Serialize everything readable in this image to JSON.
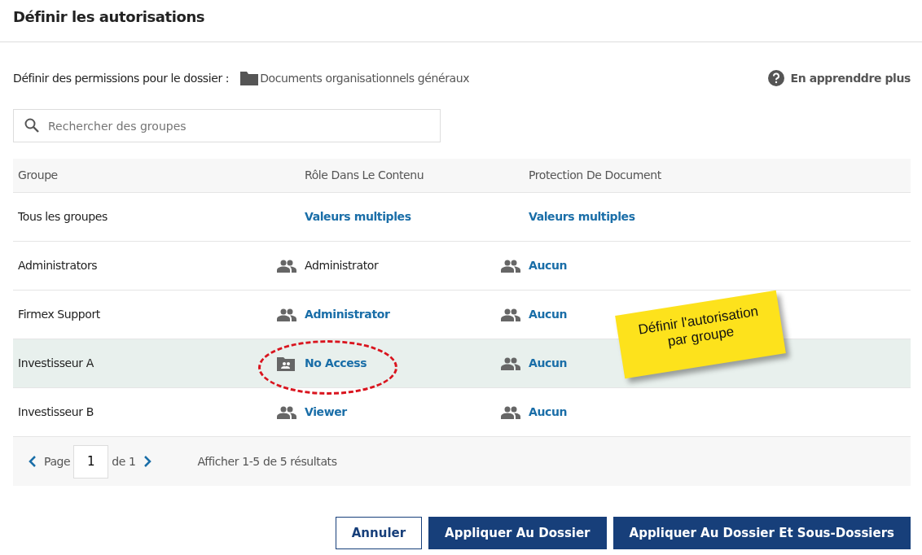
{
  "dialog": {
    "title": "Définir les autorisations"
  },
  "folder_line": {
    "label": "Définir des permissions pour le dossier :",
    "folder": "Documents organisationnels généraux"
  },
  "help_link": "En apprenddre plus",
  "search": {
    "placeholder": "Rechercher des groupes"
  },
  "table": {
    "columns": [
      "Groupe",
      "Rôle Dans Le Contenu",
      "Protection De Document"
    ],
    "rows": [
      {
        "group": "Tous les groupes",
        "selected": false,
        "role": {
          "text": "Valeurs multiples",
          "link": true,
          "kind": "summary"
        },
        "protection": {
          "text": "Valeurs multiples",
          "link": true,
          "kind": "summary"
        }
      },
      {
        "group": "Administrators",
        "selected": false,
        "role": {
          "text": "Administrator",
          "link": false,
          "kind": "group"
        },
        "protection": {
          "text": "Aucun",
          "link": true,
          "kind": "group"
        }
      },
      {
        "group": "Firmex Support",
        "selected": false,
        "role": {
          "text": "Administrator",
          "link": true,
          "kind": "group"
        },
        "protection": {
          "text": "Aucun",
          "link": true,
          "kind": "group"
        }
      },
      {
        "group": "Investisseur A",
        "selected": true,
        "role": {
          "text": "No Access",
          "link": true,
          "kind": "restricted"
        },
        "protection": {
          "text": "Aucun",
          "link": true,
          "kind": "group"
        }
      },
      {
        "group": "Investisseur B",
        "selected": false,
        "role": {
          "text": "Viewer",
          "link": true,
          "kind": "group"
        },
        "protection": {
          "text": "Aucun",
          "link": true,
          "kind": "group"
        }
      }
    ]
  },
  "pagination": {
    "page_label": "Page",
    "page": "1",
    "of_label": "de 1",
    "summary": "Afficher 1-5 de 5 résultats"
  },
  "callout": {
    "text": "Définir l'autorisation par groupe"
  },
  "buttons": [
    {
      "label": "Annuler",
      "kind": "secondary"
    },
    {
      "label": "Appliquer Au Dossier",
      "kind": "primary"
    },
    {
      "label": "Appliquer Au Dossier Et Sous-Dossiers",
      "kind": "primary"
    }
  ]
}
